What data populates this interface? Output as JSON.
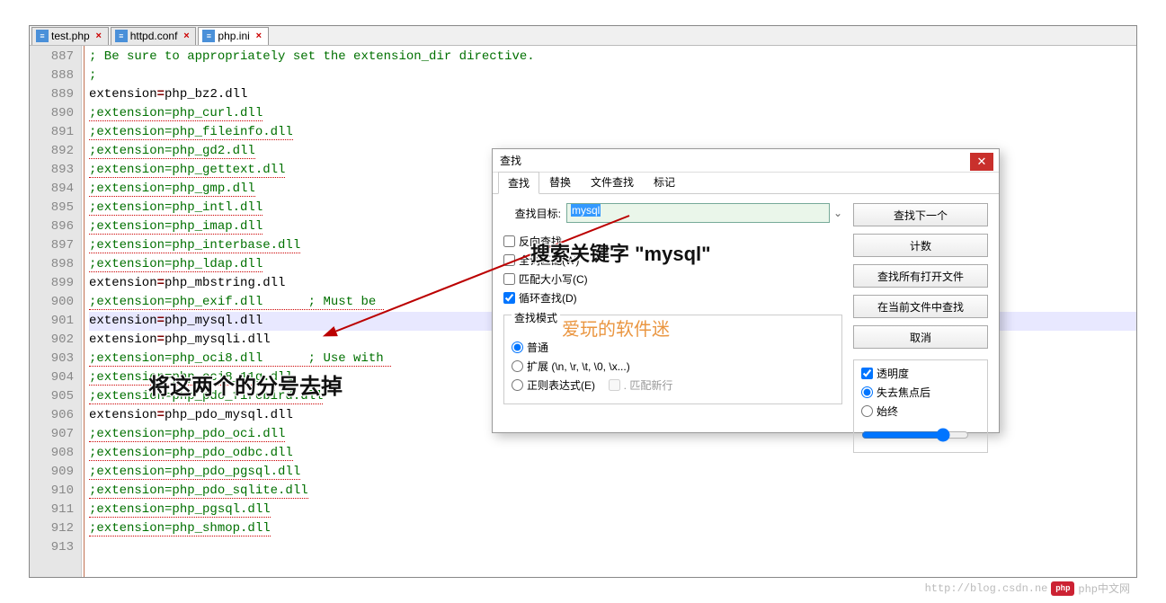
{
  "tabs": [
    {
      "label": "test.php",
      "active": false
    },
    {
      "label": "httpd.conf",
      "active": false
    },
    {
      "label": "php.ini",
      "active": true
    }
  ],
  "gutter": [
    "887",
    "888",
    "889",
    "890",
    "891",
    "892",
    "893",
    "894",
    "895",
    "896",
    "897",
    "898",
    "899",
    "900",
    "901",
    "902",
    "903",
    "904",
    "905",
    "906",
    "907",
    "908",
    "909",
    "910",
    "911",
    "912",
    "913"
  ],
  "code": {
    "l887": "; Be sure to appropriately set the extension_dir directive.",
    "l888": ";",
    "l889_a": "extension",
    "l889_b": "=",
    "l889_c": "php_bz2.dll",
    "l890": ";extension=php_curl.dll",
    "l891": ";extension=php_fileinfo.dll",
    "l892": ";extension=php_gd2.dll",
    "l893": ";extension=php_gettext.dll",
    "l894": ";extension=php_gmp.dll",
    "l895": ";extension=php_intl.dll",
    "l896": ";extension=php_imap.dll",
    "l897": ";extension=php_interbase.dll",
    "l898": ";extension=php_ldap.dll",
    "l899_a": "extension",
    "l899_b": "=",
    "l899_c": "php_mbstring.dll",
    "l900": ";extension=php_exif.dll      ; Must be ",
    "l901_a": "extension",
    "l901_b": "=",
    "l901_c": "php_mysql.dll",
    "l902_a": "extension",
    "l902_b": "=",
    "l902_c": "php_mysqli.dll",
    "l903": ";extension=php_oci8.dll      ; Use with ",
    "l904": ";extension=php_oci8_11g.dll",
    "l905": ";extension=php_pdo_firebird.dll",
    "l906_a": "extension",
    "l906_b": "=",
    "l906_c": "php_pdo_mysql.dll",
    "l907": ";extension=php_pdo_oci.dll",
    "l908": ";extension=php_pdo_odbc.dll",
    "l909": ";extension=php_pdo_pgsql.dll",
    "l910": ";extension=php_pdo_sqlite.dll",
    "l911": ";extension=php_pgsql.dll",
    "l912": ";extension=php_shmop.dll"
  },
  "find": {
    "title": "查找",
    "tabs": {
      "find": "查找",
      "replace": "替换",
      "findfiles": "文件查找",
      "mark": "标记"
    },
    "target_label": "查找目标:",
    "target_value": "mysql",
    "buttons": {
      "next": "查找下一个",
      "count": "计数",
      "allopen": "查找所有打开文件",
      "current": "在当前文件中查找",
      "cancel": "取消"
    },
    "opts": {
      "backward": "反向查找",
      "whole": "全词匹配(W)",
      "case": "匹配大小写(C)",
      "wrap": "循环查找(D)"
    },
    "mode": {
      "legend": "查找模式",
      "normal": "普通",
      "extended": "扩展 (\\n, \\r, \\t, \\0, \\x...)",
      "regex": "正则表达式(E)",
      "newline": ". 匹配新行"
    },
    "trans": {
      "legend": "透明度",
      "onblur": "失去焦点后",
      "always": "始终"
    }
  },
  "anno": {
    "search": "搜索关键字 \"mysql\"",
    "semicolon": "将这两个的分号去掉",
    "wm": "爱玩的软件迷"
  },
  "footer": {
    "url": "http://blog.csdn.ne",
    "site": "php中文网",
    "logo": "php"
  }
}
